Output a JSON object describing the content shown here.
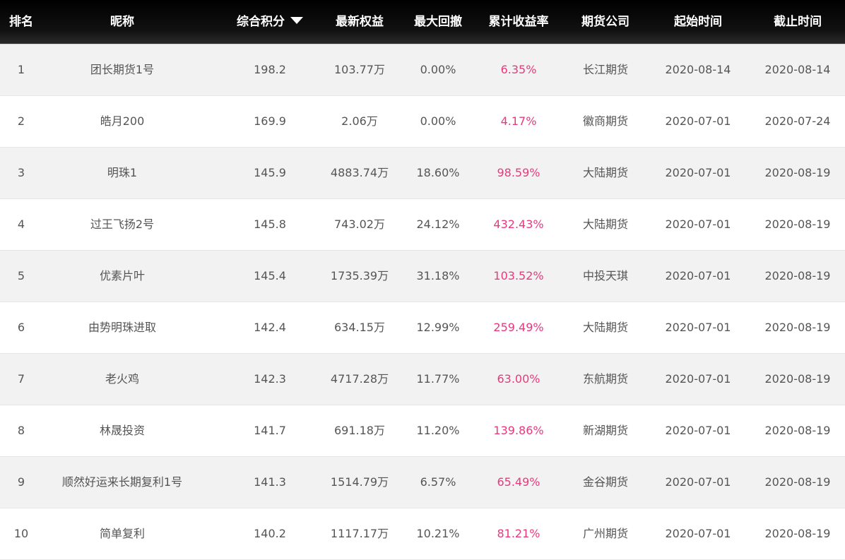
{
  "header": {
    "rank": "排名",
    "nickname": "昵称",
    "score": "综合积分",
    "score_sort_icon": "caret-down-icon",
    "equity": "最新权益",
    "max_drawdown": "最大回撤",
    "cumulative_return": "累计收益率",
    "futures_company": "期货公司",
    "start_time": "起始时间",
    "end_time": "截止时间"
  },
  "colors": {
    "header_bg": "#000000",
    "header_text": "#ffffff",
    "row_alt_bg": "#f2f2f2",
    "return_text": "#e8397d",
    "body_text": "#555555"
  },
  "rows": [
    {
      "rank": "1",
      "name": "团长期货1号",
      "score": "198.2",
      "equity": "103.77万",
      "drawdown": "0.00%",
      "rate": "6.35%",
      "company": "长江期货",
      "start": "2020-08-14",
      "end": "2020-08-14"
    },
    {
      "rank": "2",
      "name": "皓月200",
      "score": "169.9",
      "equity": "2.06万",
      "drawdown": "0.00%",
      "rate": "4.17%",
      "company": "徽商期货",
      "start": "2020-07-01",
      "end": "2020-07-24"
    },
    {
      "rank": "3",
      "name": "明珠1",
      "score": "145.9",
      "equity": "4883.74万",
      "drawdown": "18.60%",
      "rate": "98.59%",
      "company": "大陆期货",
      "start": "2020-07-01",
      "end": "2020-08-19"
    },
    {
      "rank": "4",
      "name": "过王飞扬2号",
      "score": "145.8",
      "equity": "743.02万",
      "drawdown": "24.12%",
      "rate": "432.43%",
      "company": "大陆期货",
      "start": "2020-07-01",
      "end": "2020-08-19"
    },
    {
      "rank": "5",
      "name": "优素片叶",
      "score": "145.4",
      "equity": "1735.39万",
      "drawdown": "31.18%",
      "rate": "103.52%",
      "company": "中投天琪",
      "start": "2020-07-01",
      "end": "2020-08-19"
    },
    {
      "rank": "6",
      "name": "由势明珠进取",
      "score": "142.4",
      "equity": "634.15万",
      "drawdown": "12.99%",
      "rate": "259.49%",
      "company": "大陆期货",
      "start": "2020-07-01",
      "end": "2020-08-19"
    },
    {
      "rank": "7",
      "name": "老火鸡",
      "score": "142.3",
      "equity": "4717.28万",
      "drawdown": "11.77%",
      "rate": "63.00%",
      "company": "东航期货",
      "start": "2020-07-01",
      "end": "2020-08-19"
    },
    {
      "rank": "8",
      "name": "林晟投资",
      "score": "141.7",
      "equity": "691.18万",
      "drawdown": "11.20%",
      "rate": "139.86%",
      "company": "新湖期货",
      "start": "2020-07-01",
      "end": "2020-08-19"
    },
    {
      "rank": "9",
      "name": "顺然好运来长期复利1号",
      "score": "141.3",
      "equity": "1514.79万",
      "drawdown": "6.57%",
      "rate": "65.49%",
      "company": "金谷期货",
      "start": "2020-07-01",
      "end": "2020-08-19"
    },
    {
      "rank": "10",
      "name": "简单复利",
      "score": "140.2",
      "equity": "1117.17万",
      "drawdown": "10.21%",
      "rate": "81.21%",
      "company": "广州期货",
      "start": "2020-07-01",
      "end": "2020-08-19"
    }
  ]
}
